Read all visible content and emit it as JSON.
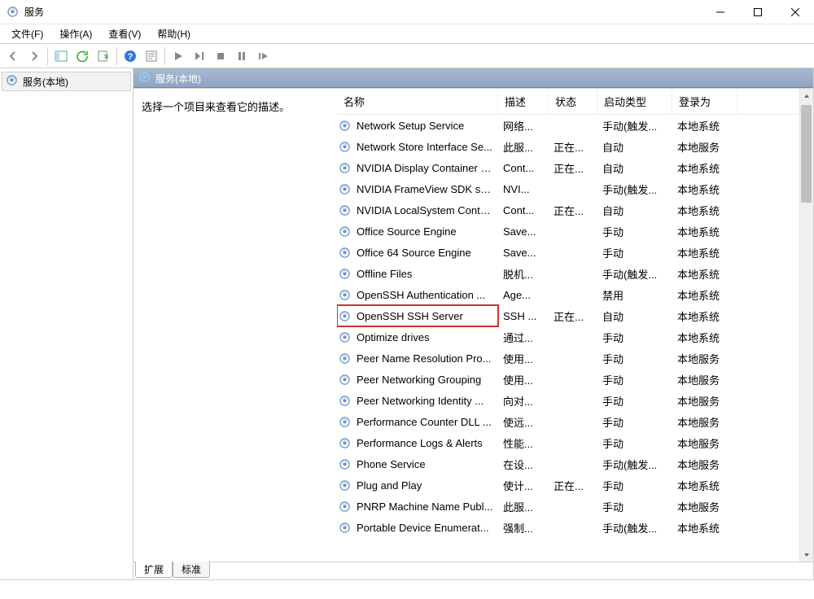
{
  "window": {
    "title": "服务"
  },
  "menu": {
    "file": "文件(F)",
    "action": "操作(A)",
    "view": "查看(V)",
    "help": "帮助(H)"
  },
  "tree": {
    "root_label": "服务(本地)"
  },
  "pane_header": "服务(本地)",
  "detail_prompt": "选择一个项目来查看它的描述。",
  "columns": {
    "name": "名称",
    "desc": "描述",
    "state": "状态",
    "startup": "启动类型",
    "logon": "登录为"
  },
  "tabs": {
    "extended": "扩展",
    "standard": "标准"
  },
  "services": [
    {
      "name": "Network Setup Service",
      "desc": "网络...",
      "state": "",
      "startup": "手动(触发...",
      "logon": "本地系统"
    },
    {
      "name": "Network Store Interface Se...",
      "desc": "此服...",
      "state": "正在...",
      "startup": "自动",
      "logon": "本地服务"
    },
    {
      "name": "NVIDIA Display Container LS",
      "desc": "Cont...",
      "state": "正在...",
      "startup": "自动",
      "logon": "本地系统"
    },
    {
      "name": "NVIDIA FrameView SDK se...",
      "desc": "NVI...",
      "state": "",
      "startup": "手动(触发...",
      "logon": "本地系统"
    },
    {
      "name": "NVIDIA LocalSystem Conta...",
      "desc": "Cont...",
      "state": "正在...",
      "startup": "自动",
      "logon": "本地系统"
    },
    {
      "name": "Office  Source Engine",
      "desc": "Save...",
      "state": "",
      "startup": "手动",
      "logon": "本地系统"
    },
    {
      "name": "Office 64 Source Engine",
      "desc": "Save...",
      "state": "",
      "startup": "手动",
      "logon": "本地系统"
    },
    {
      "name": "Offline Files",
      "desc": "脱机...",
      "state": "",
      "startup": "手动(触发...",
      "logon": "本地系统"
    },
    {
      "name": "OpenSSH Authentication ...",
      "desc": "Age...",
      "state": "",
      "startup": "禁用",
      "logon": "本地系统"
    },
    {
      "name": "OpenSSH SSH Server",
      "desc": "SSH ...",
      "state": "正在...",
      "startup": "自动",
      "logon": "本地系统",
      "highlight": true
    },
    {
      "name": "Optimize drives",
      "desc": "通过...",
      "state": "",
      "startup": "手动",
      "logon": "本地系统"
    },
    {
      "name": "Peer Name Resolution Pro...",
      "desc": "使用...",
      "state": "",
      "startup": "手动",
      "logon": "本地服务"
    },
    {
      "name": "Peer Networking Grouping",
      "desc": "使用...",
      "state": "",
      "startup": "手动",
      "logon": "本地服务"
    },
    {
      "name": "Peer Networking Identity ...",
      "desc": "向对...",
      "state": "",
      "startup": "手动",
      "logon": "本地服务"
    },
    {
      "name": "Performance Counter DLL ...",
      "desc": "使远...",
      "state": "",
      "startup": "手动",
      "logon": "本地服务"
    },
    {
      "name": "Performance Logs & Alerts",
      "desc": "性能...",
      "state": "",
      "startup": "手动",
      "logon": "本地服务"
    },
    {
      "name": "Phone Service",
      "desc": "在设...",
      "state": "",
      "startup": "手动(触发...",
      "logon": "本地服务"
    },
    {
      "name": "Plug and Play",
      "desc": "使计...",
      "state": "正在...",
      "startup": "手动",
      "logon": "本地系统"
    },
    {
      "name": "PNRP Machine Name Publ...",
      "desc": "此服...",
      "state": "",
      "startup": "手动",
      "logon": "本地服务"
    },
    {
      "name": "Portable Device Enumerat...",
      "desc": "强制...",
      "state": "",
      "startup": "手动(触发...",
      "logon": "本地系统"
    }
  ]
}
